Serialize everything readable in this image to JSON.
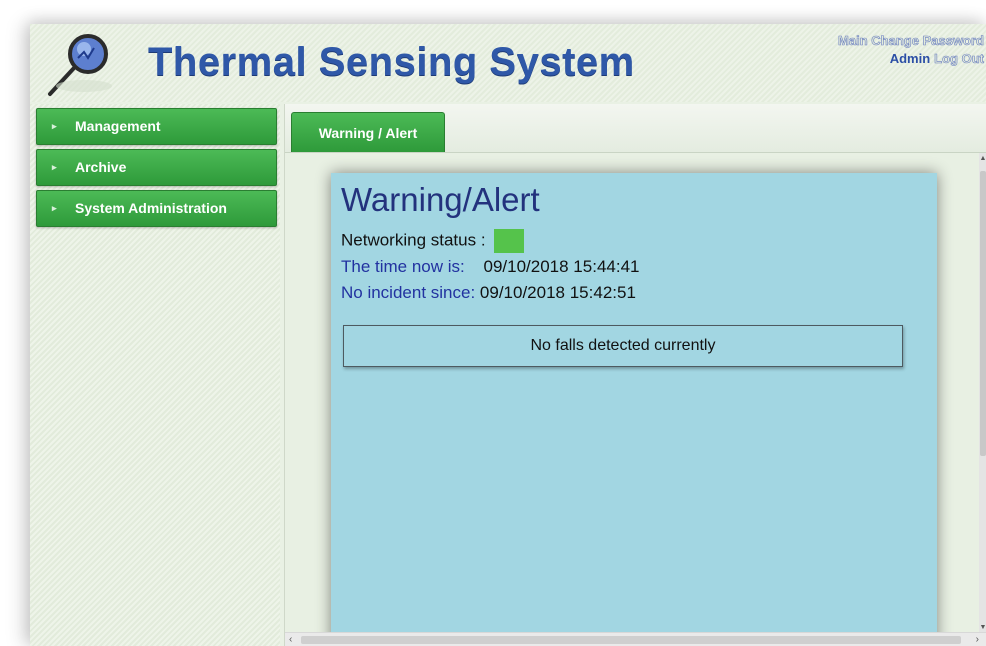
{
  "header": {
    "title": "Thermal Sensing System",
    "logo_icon": "magnifier-icon",
    "links": {
      "main": "Main",
      "change_password": "Change Password",
      "user": "Admin",
      "logout": "Log Out"
    }
  },
  "sidebar": {
    "items": [
      {
        "label": "Management"
      },
      {
        "label": "Archive"
      },
      {
        "label": "System Administration"
      }
    ]
  },
  "tabs": [
    {
      "label": "Warning / Alert"
    }
  ],
  "alert": {
    "heading": "Warning/Alert",
    "network_label": "Networking status :",
    "network_status_color": "#55c34b",
    "time_label": "The time now is:",
    "time_value": "09/10/2018 15:44:41",
    "incident_label": "No incident since:",
    "incident_value": "09/10/2018 15:42:51",
    "message": "No falls detected currently"
  },
  "colors": {
    "accent_green": "#3aa845",
    "title_blue": "#2f58a8",
    "panel_blue": "#a2d6e2"
  }
}
